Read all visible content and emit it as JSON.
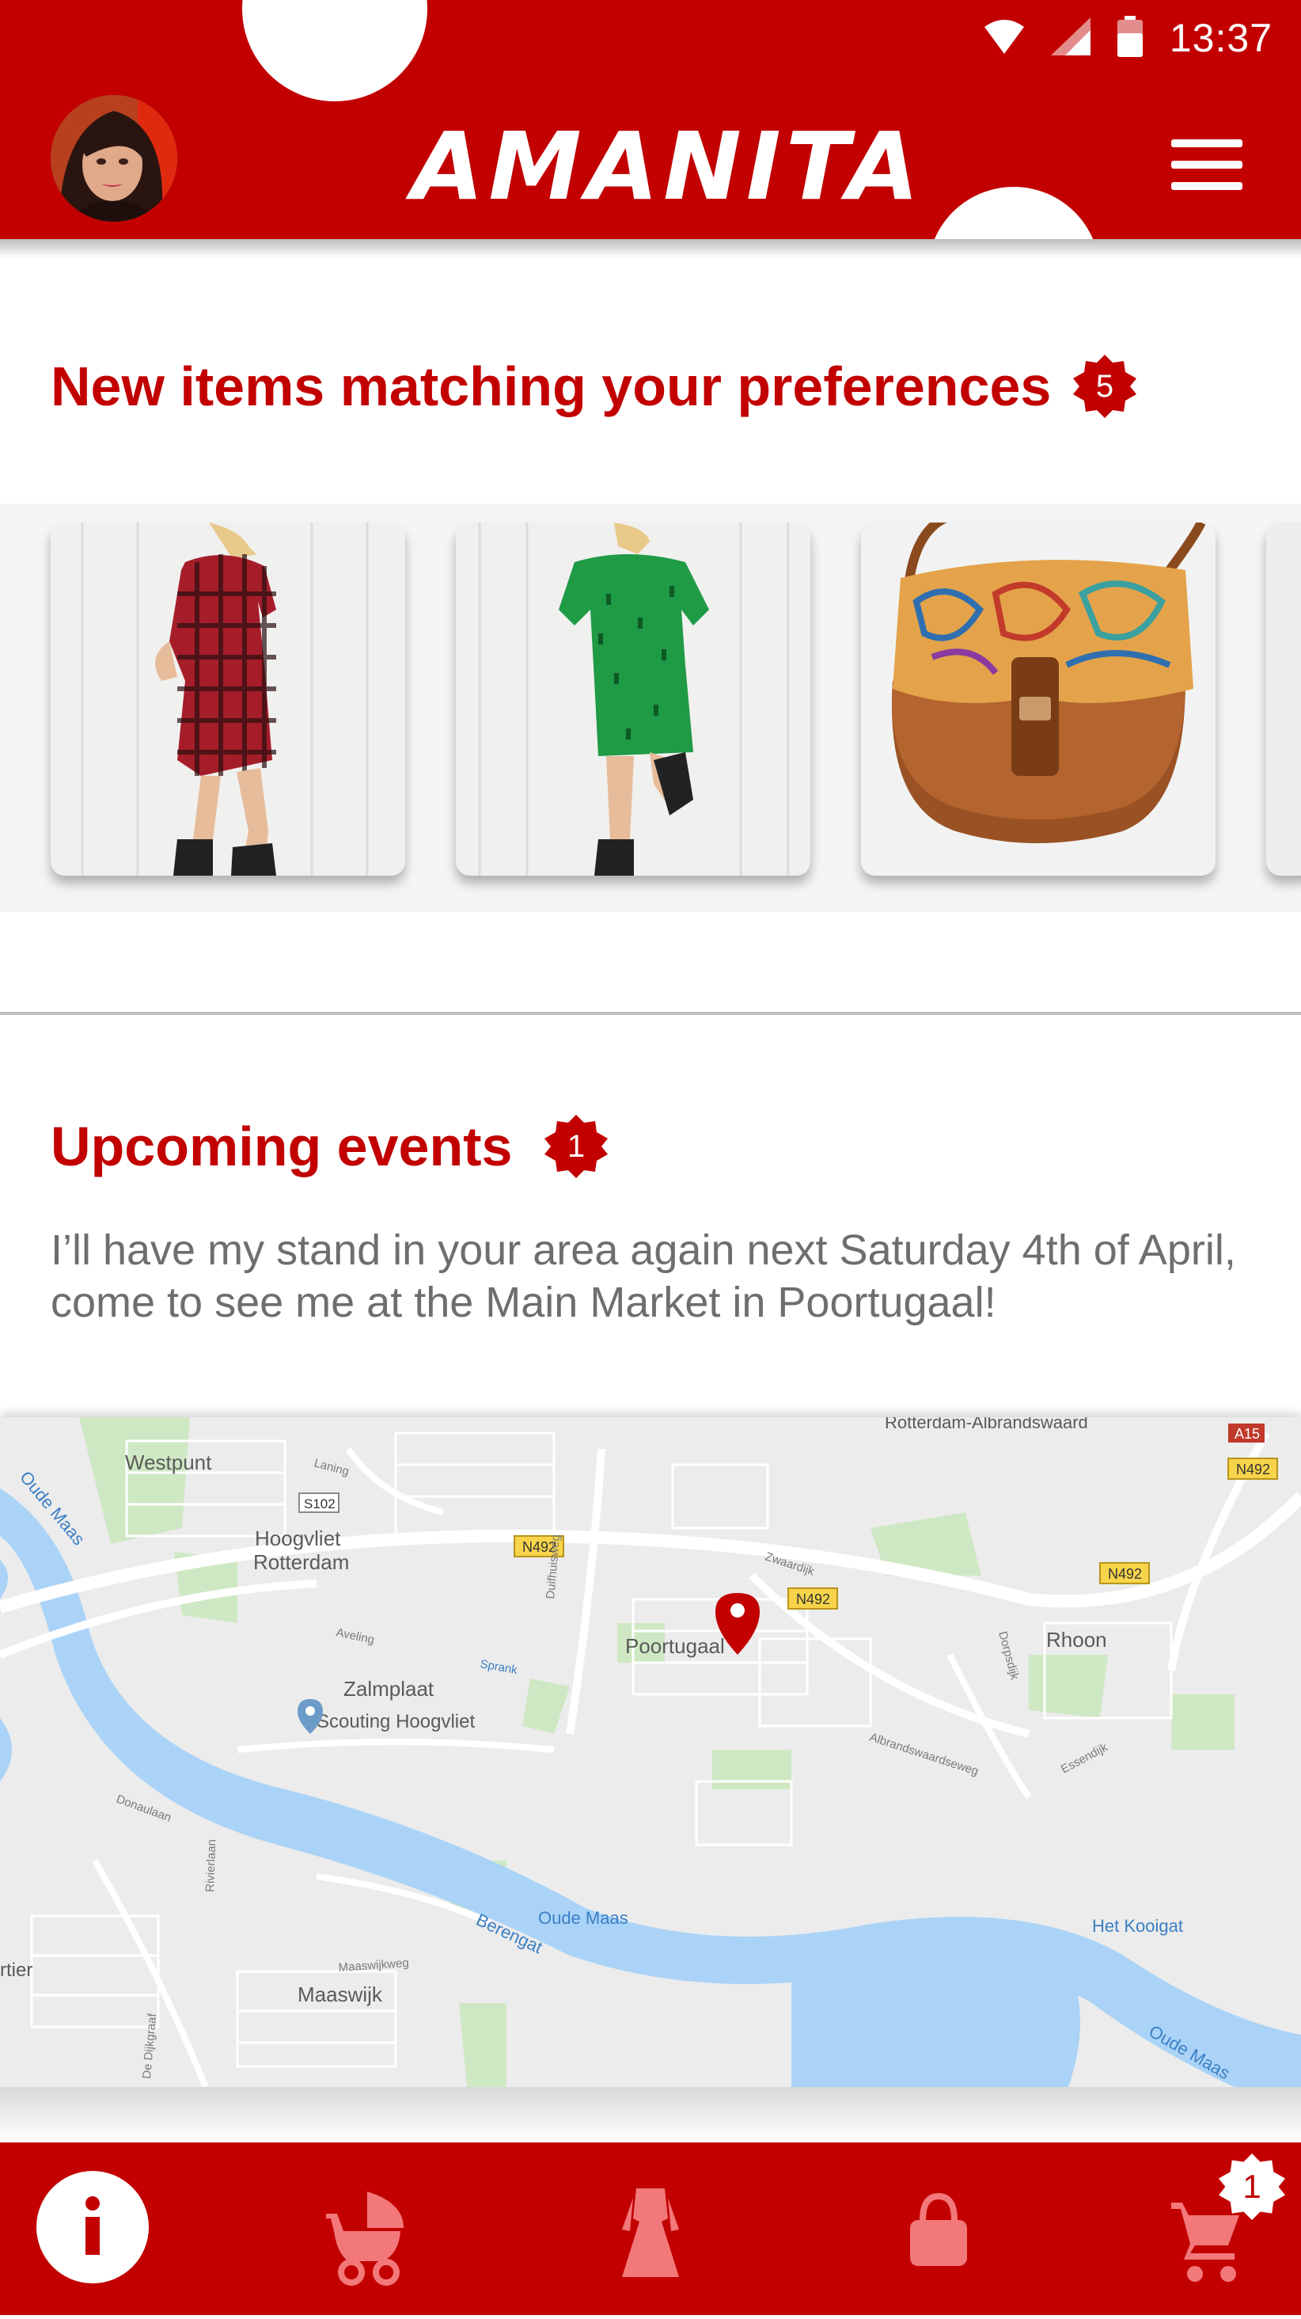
{
  "status_bar": {
    "time": "13:37"
  },
  "header": {
    "brand": "AMANITA"
  },
  "new_items": {
    "title": "New items matching your preferences",
    "badge_count": "5",
    "items": [
      {
        "name": "red-checked-dress"
      },
      {
        "name": "green-dress"
      },
      {
        "name": "paisley-leather-bag"
      }
    ]
  },
  "events": {
    "title": "Upcoming events",
    "badge_count": "1",
    "text": "I’ll have my stand in your area again next Saturday 4th of April, come to see me at the Main Market in Poortugaal!"
  },
  "map": {
    "labels": {
      "westpunt": "Westpunt",
      "hoogvliet": "Hoogvliet",
      "rotterdam": "Rotterdam",
      "zalmplaat": "Zalmplaat",
      "scouting": "Scouting Hoogvliet",
      "poortugaal": "Poortugaal",
      "rhoon": "Rhoon",
      "oude_maas_1": "Oude Maas",
      "oude_maas_2": "Oude Maas",
      "oude_maas_3": "Oude Maas",
      "berengat": "Berengat",
      "het_kooigat": "Het Kooigat",
      "maaswijk": "Maaswijk",
      "rotterdam_albrandswaard": "Rotterdam-Albrandswaard",
      "laning": "Laning",
      "aveling": "Aveling",
      "sprank": "Sprank",
      "zwaardijk": "Zwaardijk",
      "albrandswaardseweg": "Albrandswaardseweg",
      "essendijk": "Essendijk",
      "dorpsdijk": "Dorpsdijk",
      "duifhuisweg": "Duifhuisweg",
      "donaulaan": "Donaulaan",
      "rivierlaan": "Rivierlaan",
      "maaswijkweg": "Maaswijkweg",
      "de_dijkgraaf": "De Dijkgraaf",
      "rtier": "rtier",
      "s102": "S102",
      "n492_a": "N492",
      "n492_b": "N492",
      "n492_c": "N492",
      "n492_d": "N492",
      "a15": "A15"
    }
  },
  "bottom_nav": {
    "items": [
      "info",
      "baby-stroller",
      "dress",
      "bag",
      "cart"
    ],
    "cart_badge": "1"
  },
  "colors": {
    "primary": "#c20000",
    "text_grey": "#6e6e6e"
  }
}
